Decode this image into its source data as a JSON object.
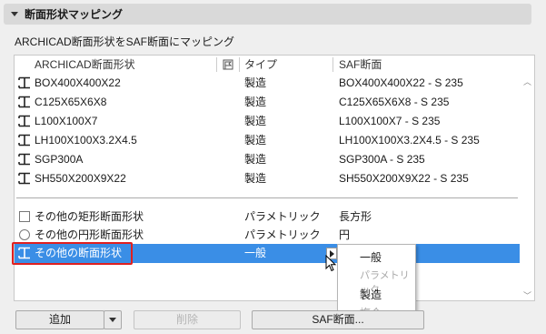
{
  "section": {
    "title": "断面形状マッピング"
  },
  "subtitle": "ARCHICAD断面形状をSAF断面にマッピング",
  "columns": {
    "archicad": "ARCHICAD断面形状",
    "type": "タイプ",
    "saf": "SAF断面"
  },
  "profile_rows": [
    {
      "name": "BOX400X400X22",
      "type": "製造",
      "saf": "BOX400X400X22 - S 235"
    },
    {
      "name": "C125X65X6X8",
      "type": "製造",
      "saf": "C125X65X6X8 - S 235"
    },
    {
      "name": "L100X100X7",
      "type": "製造",
      "saf": "L100X100X7 - S 235"
    },
    {
      "name": "LH100X100X3.2X4.5",
      "type": "製造",
      "saf": "LH100X100X3.2X4.5 - S 235"
    },
    {
      "name": "SGP300A",
      "type": "製造",
      "saf": "SGP300A - S 235"
    },
    {
      "name": "SH550X200X9X22",
      "type": "製造",
      "saf": "SH550X200X9X22 - S 235"
    }
  ],
  "other_rows": [
    {
      "name": "その他の矩形断面形状",
      "type": "パラメトリック",
      "saf": "長方形"
    },
    {
      "name": "その他の円形断面形状",
      "type": "パラメトリック",
      "saf": "円"
    },
    {
      "name": "その他の断面形状",
      "type": "一般",
      "saf": ""
    }
  ],
  "popup": [
    {
      "label": "一般",
      "disabled": false
    },
    {
      "label": "パラメトリック",
      "disabled": true
    },
    {
      "label": "製造",
      "disabled": false
    },
    {
      "label": "複合",
      "disabled": true
    }
  ],
  "buttons": {
    "add": "追加",
    "delete": "削除",
    "saf": "SAF断面..."
  },
  "colors": {
    "selection": "#3a8ee6",
    "highlight_box": "#e02020"
  }
}
